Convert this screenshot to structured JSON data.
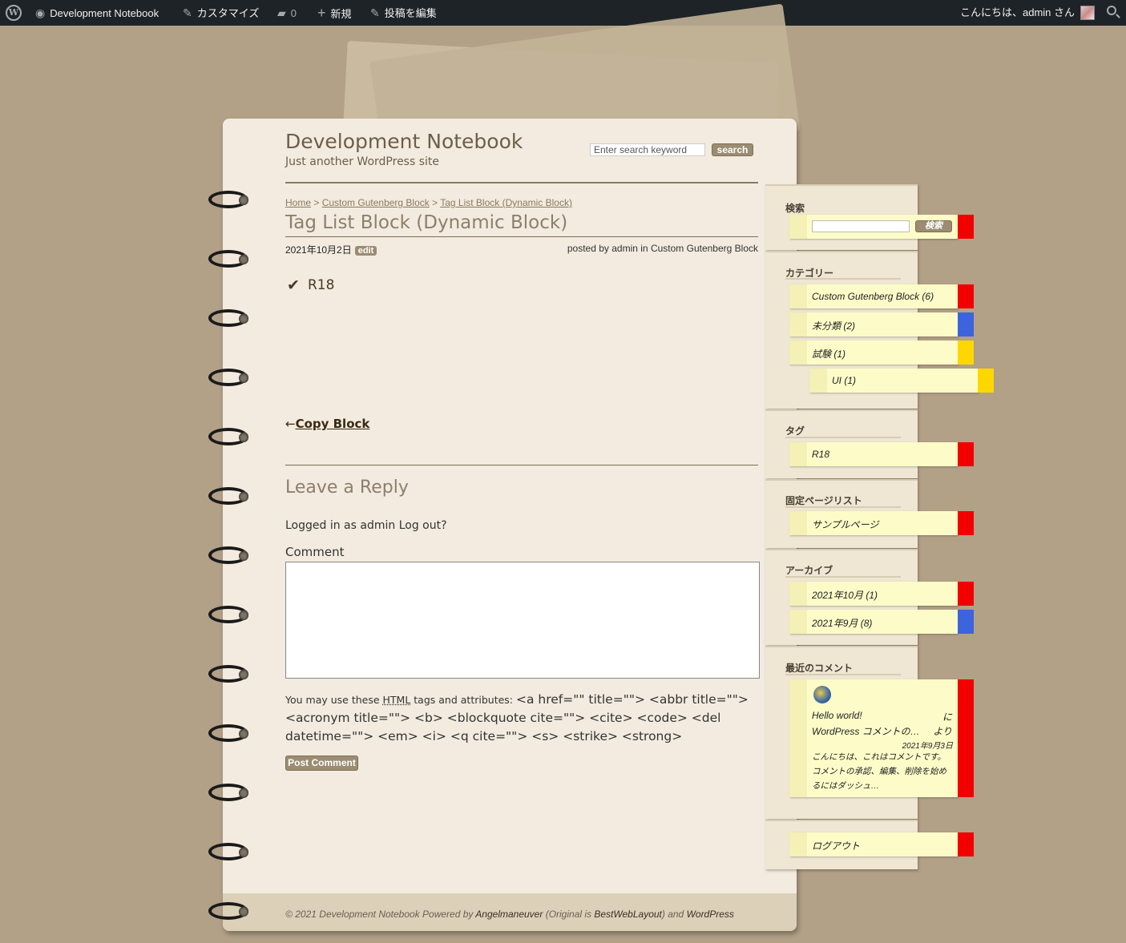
{
  "adminbar": {
    "site_name": "Development Notebook",
    "customize": "カスタマイズ",
    "comments_count": "0",
    "new": "新規",
    "edit_post": "投稿を編集",
    "greeting": "こんにちは、admin さん"
  },
  "site": {
    "title": "Development Notebook",
    "description": "Just another WordPress site",
    "search_placeholder": "Enter search keyword",
    "search_button": "search"
  },
  "breadcrumb": {
    "home": "Home",
    "sep1": " > ",
    "category": "Custom Gutenberg Block",
    "sep2": " > ",
    "current": "Tag List Block (Dynamic Block)"
  },
  "post": {
    "title": "Tag List Block (Dynamic Block)",
    "date": "2021年10月2日",
    "edit": "edit",
    "meta_prefix": "posted by ",
    "author": "admin",
    "meta_in": " in ",
    "category": "Custom Gutenberg Block",
    "tag_check": "✔",
    "tag": "R18",
    "prev_arrow": "←",
    "prev_link": "Copy Block"
  },
  "comments": {
    "reply_title": "Leave a Reply",
    "logged_in": "Logged in as admin Log out?",
    "comment_label": "Comment",
    "allowed_prefix": "You may use these ",
    "allowed_html": "HTML",
    "allowed_mid": " tags and attributes: ",
    "allowed_tags": "<a href=\"\" title=\"\"> <abbr title=\"\"> <acronym title=\"\"> <b> <blockquote cite=\"\"> <cite> <code> <del datetime=\"\"> <em> <i> <q cite=\"\"> <s> <strike> <strong>",
    "post_button": "Post Comment"
  },
  "footer": {
    "prefix": "© 2021 Development Notebook Powered by ",
    "author": "Angelmaneuver",
    "mid": " (Original is ",
    "original": "BestWebLayout",
    "and": ") and ",
    "wp": "WordPress"
  },
  "sidebar": {
    "search": {
      "title": "検索",
      "button": "検索"
    },
    "categories": {
      "title": "カテゴリー",
      "items": [
        {
          "label": "Custom Gutenberg Block (6)",
          "color": "#f20000"
        },
        {
          "label": "未分類 (2)",
          "color": "#3c64dc"
        },
        {
          "label": "試験 (1)",
          "color": "#ffd700"
        },
        {
          "label": "UI (1)",
          "color": "#ffd700"
        }
      ]
    },
    "tags": {
      "title": "タグ",
      "items": [
        {
          "label": "R18"
        }
      ]
    },
    "pages": {
      "title": "固定ページリスト",
      "items": [
        {
          "label": "サンプルページ"
        }
      ]
    },
    "archives": {
      "title": "アーカイブ",
      "items": [
        {
          "label": "2021年10月 (1)"
        },
        {
          "label": "2021年9月 (8)"
        }
      ]
    },
    "recent_comments": {
      "title": "最近のコメント",
      "post": "Hello world!",
      "ni": "に",
      "author": "WordPress コメントの…",
      "yori": "より",
      "date": "2021年9月3日",
      "excerpt": "こんにちは、これはコメントです。コメントの承認、編集、削除を始めるにはダッシュ…"
    },
    "logout": "ログアウト"
  }
}
